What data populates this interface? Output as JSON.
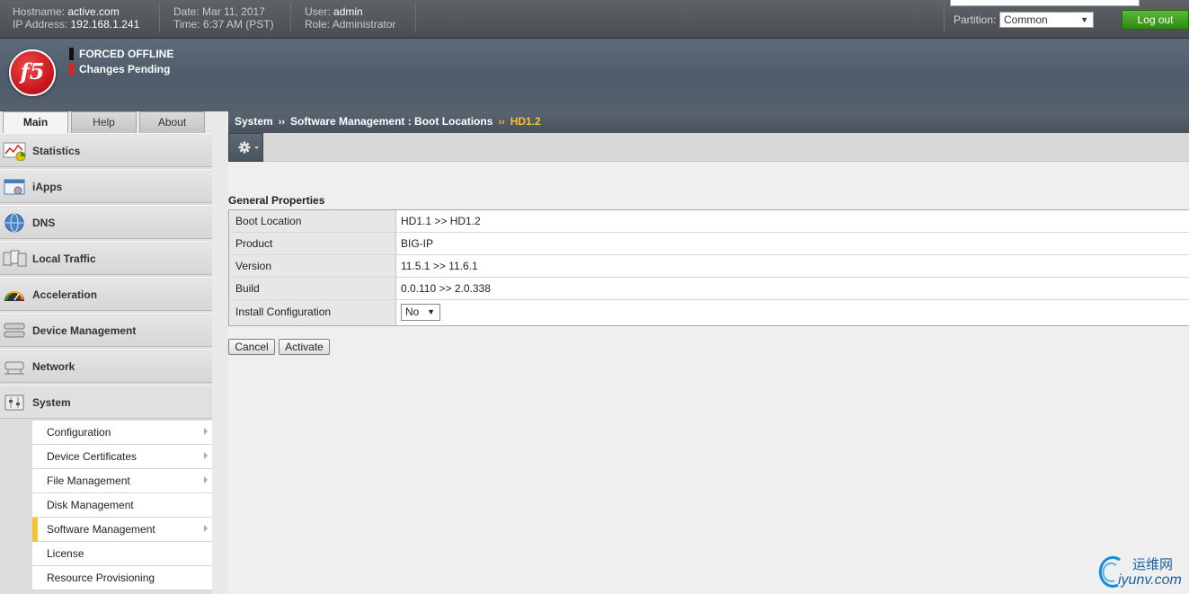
{
  "topbar": {
    "hostname_label": "Hostname:",
    "hostname": "active.com",
    "ip_label": "IP Address:",
    "ip": "192.168.1.241",
    "date_label": "Date:",
    "date": "Mar 11, 2017",
    "time_label": "Time:",
    "time": "6:37 AM (PST)",
    "user_label": "User:",
    "user": "admin",
    "role_label": "Role:",
    "role": "Administrator",
    "partition_label": "Partition:",
    "partition_value": "Common",
    "logout_label": "Log out"
  },
  "banner": {
    "logo_text": "f5",
    "status_lines": [
      {
        "text": "FORCED OFFLINE",
        "color": "#111111"
      },
      {
        "text": "Changes Pending",
        "color": "#e02020"
      }
    ]
  },
  "tabs": [
    {
      "label": "Main",
      "active": true
    },
    {
      "label": "Help",
      "active": false
    },
    {
      "label": "About",
      "active": false
    }
  ],
  "nav": {
    "items": [
      {
        "label": "Statistics",
        "icon": "statistics-icon"
      },
      {
        "label": "iApps",
        "icon": "iapps-icon"
      },
      {
        "label": "DNS",
        "icon": "dns-globe-icon"
      },
      {
        "label": "Local Traffic",
        "icon": "local-traffic-icon"
      },
      {
        "label": "Acceleration",
        "icon": "acceleration-gauge-icon"
      },
      {
        "label": "Device Management",
        "icon": "device-management-icon"
      },
      {
        "label": "Network",
        "icon": "network-icon"
      },
      {
        "label": "System",
        "icon": "system-icon"
      }
    ],
    "system_subitems": [
      {
        "label": "Configuration",
        "has_arrow": true,
        "selected": false
      },
      {
        "label": "Device Certificates",
        "has_arrow": true,
        "selected": false
      },
      {
        "label": "File Management",
        "has_arrow": true,
        "selected": false
      },
      {
        "label": "Disk Management",
        "has_arrow": false,
        "selected": false
      },
      {
        "label": "Software Management",
        "has_arrow": true,
        "selected": true
      },
      {
        "label": "License",
        "has_arrow": false,
        "selected": false
      },
      {
        "label": "Resource Provisioning",
        "has_arrow": false,
        "selected": false
      }
    ]
  },
  "breadcrumb": {
    "part1": "System",
    "part2": "Software Management : Boot Locations",
    "current": "HD1.2",
    "separator": "››"
  },
  "main": {
    "section_title": "General Properties",
    "properties": [
      {
        "label": "Boot Location",
        "value": "HD1.1 >> HD1.2"
      },
      {
        "label": "Product",
        "value": "BIG-IP"
      },
      {
        "label": "Version",
        "value": "11.5.1 >> 11.6.1"
      },
      {
        "label": "Build",
        "value": "0.0.110 >> 2.0.338"
      }
    ],
    "install_config_label": "Install Configuration",
    "install_config_value": "No",
    "cancel_label": "Cancel",
    "activate_label": "Activate"
  },
  "watermark": {
    "cn": "运维网",
    "en": "iyunv.com"
  },
  "colors": {
    "accent_yellow": "#f7c331",
    "logout_green": "#3a9a1c",
    "f5_red": "#d4141c"
  }
}
